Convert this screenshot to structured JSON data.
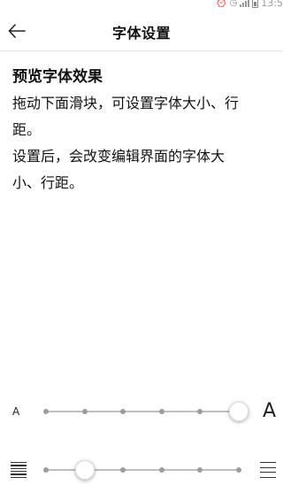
{
  "status_bar": {
    "time": "13:5"
  },
  "header": {
    "title": "字体设置"
  },
  "preview": {
    "title": "预览字体效果",
    "lines": [
      "拖动下面滑块，可设置字体大小、行",
      "距。",
      "设置后，会改变编辑界面的字体大",
      "小、行距。"
    ]
  },
  "font_size_slider": {
    "small_label": "A",
    "large_label": "A",
    "steps": 6,
    "selected_index": 5
  },
  "line_spacing_slider": {
    "steps": 6,
    "selected_index": 1,
    "min_icon": "dense-lines-icon",
    "max_icon": "loose-lines-icon"
  }
}
